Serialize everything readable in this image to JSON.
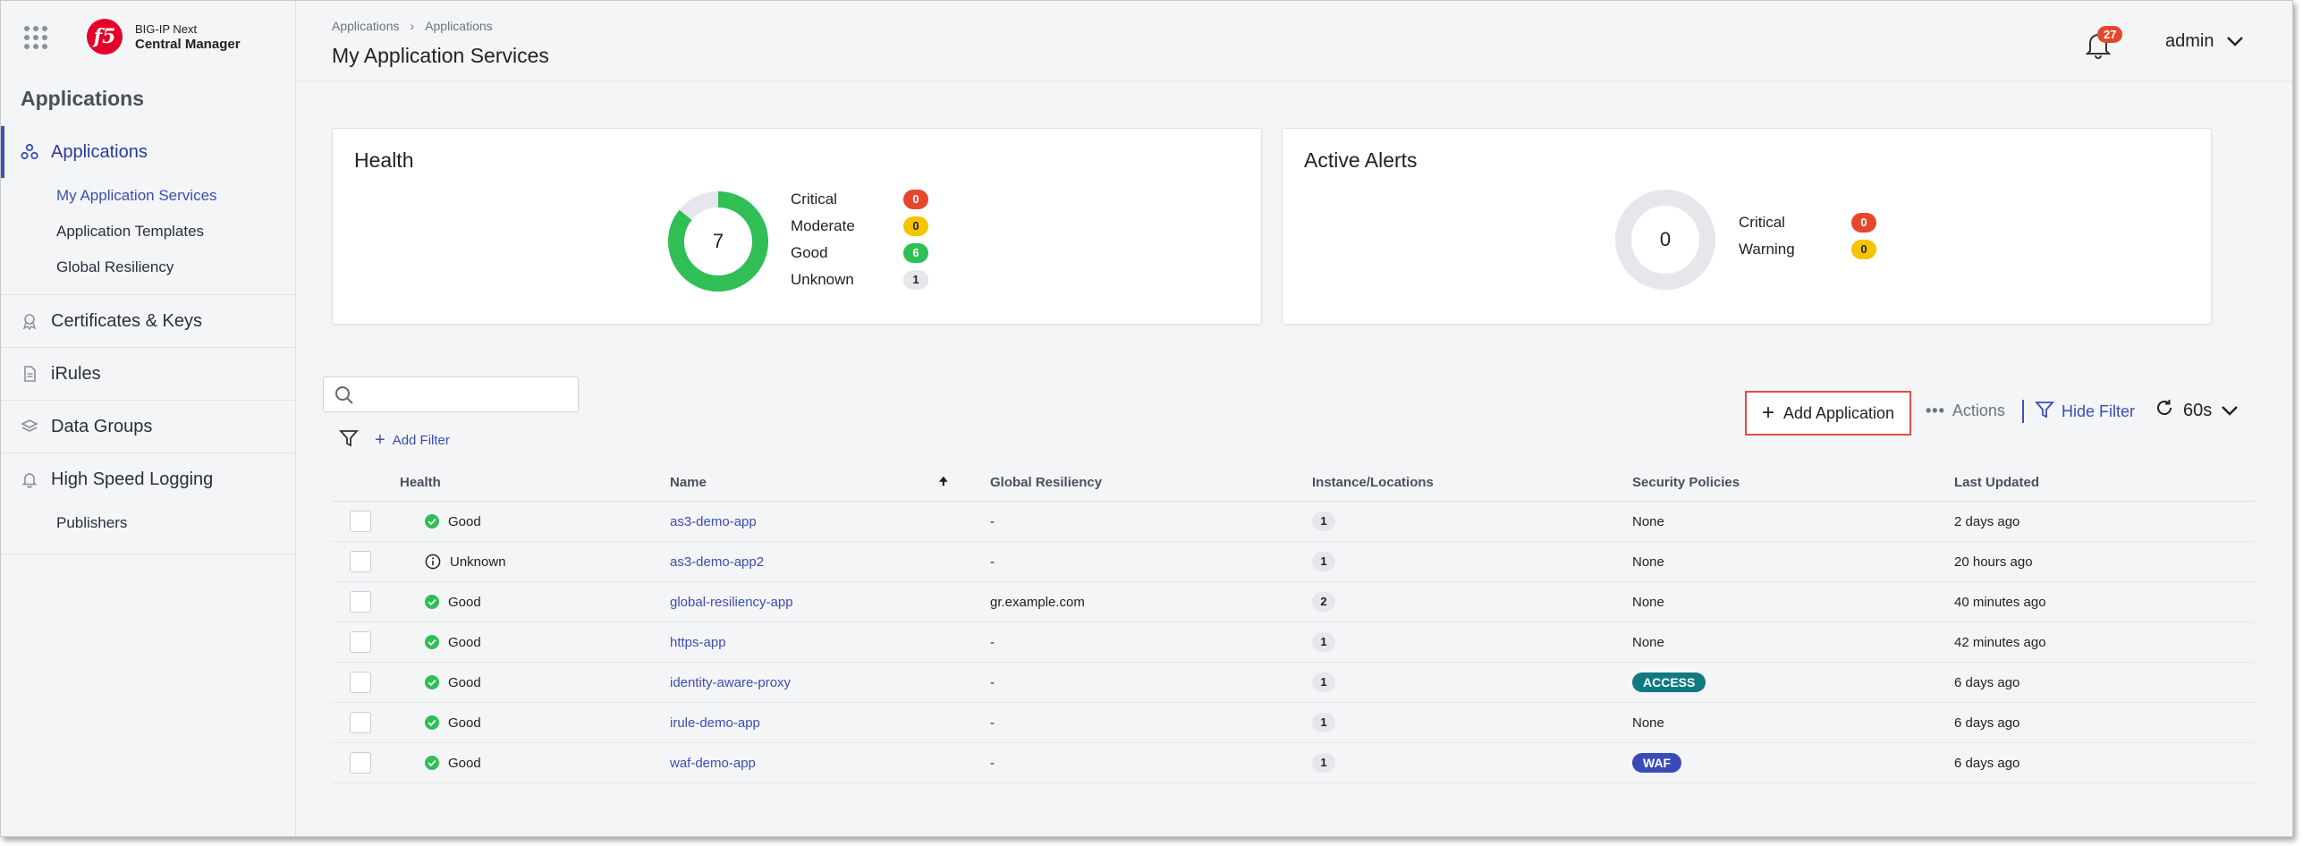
{
  "product": {
    "line1": "BIG-IP Next",
    "line2": "Central Manager",
    "logo_text": "f5"
  },
  "sidebar": {
    "title": "Applications",
    "sections": [
      {
        "label": "Applications",
        "icon": "applications-icon",
        "active": true,
        "items": [
          "My Application Services",
          "Application Templates",
          "Global Resiliency"
        ]
      },
      {
        "label": "Certificates & Keys",
        "icon": "certificate-icon",
        "items": []
      },
      {
        "label": "iRules",
        "icon": "document-icon",
        "items": []
      },
      {
        "label": "Data Groups",
        "icon": "layers-icon",
        "items": []
      },
      {
        "label": "High Speed Logging",
        "icon": "bell-icon",
        "items": [
          "Publishers"
        ]
      }
    ]
  },
  "header": {
    "breadcrumb": [
      "Applications",
      "Applications"
    ],
    "title": "My Application Services",
    "notifications": "27",
    "user": "admin"
  },
  "health_card": {
    "title": "Health",
    "total": "7",
    "legend": [
      {
        "label": "Critical",
        "count": "0",
        "color": "#e5472d"
      },
      {
        "label": "Moderate",
        "count": "0",
        "color": "#f5c400"
      },
      {
        "label": "Good",
        "count": "6",
        "color": "#2fbf55"
      },
      {
        "label": "Unknown",
        "count": "1",
        "color": "#e6e7ec"
      }
    ]
  },
  "alerts_card": {
    "title": "Active Alerts",
    "total": "0",
    "legend": [
      {
        "label": "Critical",
        "count": "0",
        "color": "#e5472d"
      },
      {
        "label": "Warning",
        "count": "0",
        "color": "#f5c400"
      }
    ]
  },
  "toolbar": {
    "search_placeholder": "",
    "add_filter": "Add Filter",
    "add_application": "Add Application",
    "actions": "Actions",
    "hide_filter": "Hide Filter",
    "refresh_interval": "60s"
  },
  "table": {
    "columns": [
      "Health",
      "Name",
      "Global Resiliency",
      "Instance/Locations",
      "Security Policies",
      "Last Updated"
    ],
    "rows": [
      {
        "health": "Good",
        "name": "as3-demo-app",
        "global": "-",
        "instances": "1",
        "security": "None",
        "updated": "2 days ago"
      },
      {
        "health": "Unknown",
        "name": "as3-demo-app2",
        "global": "-",
        "instances": "1",
        "security": "None",
        "updated": "20 hours ago"
      },
      {
        "health": "Good",
        "name": "global-resiliency-app",
        "global": "gr.example.com",
        "instances": "2",
        "security": "None",
        "updated": "40 minutes ago"
      },
      {
        "health": "Good",
        "name": "https-app",
        "global": "-",
        "instances": "1",
        "security": "None",
        "updated": "42 minutes ago"
      },
      {
        "health": "Good",
        "name": "identity-aware-proxy",
        "global": "-",
        "instances": "1",
        "security": "ACCESS",
        "updated": "6 days ago"
      },
      {
        "health": "Good",
        "name": "irule-demo-app",
        "global": "-",
        "instances": "1",
        "security": "None",
        "updated": "6 days ago"
      },
      {
        "health": "Good",
        "name": "waf-demo-app",
        "global": "-",
        "instances": "1",
        "security": "WAF",
        "updated": "6 days ago"
      }
    ]
  }
}
